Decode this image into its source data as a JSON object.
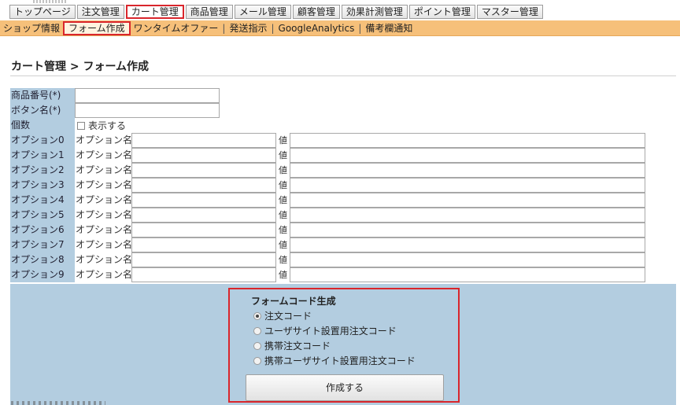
{
  "nav": {
    "tabs": [
      {
        "label": "トップページ",
        "active": false
      },
      {
        "label": "注文管理",
        "active": false
      },
      {
        "label": "カート管理",
        "active": true
      },
      {
        "label": "商品管理",
        "active": false
      },
      {
        "label": "メール管理",
        "active": false
      },
      {
        "label": "顧客管理",
        "active": false
      },
      {
        "label": "効果計測管理",
        "active": false
      },
      {
        "label": "ポイント管理",
        "active": false
      },
      {
        "label": "マスター管理",
        "active": false
      }
    ],
    "subnav": [
      {
        "label": "ショップ情報",
        "current": false
      },
      {
        "label": "フォーム作成",
        "current": true
      },
      {
        "label": "ワンタイムオファー",
        "current": false
      },
      {
        "label": "発送指示",
        "current": false
      },
      {
        "label": "GoogleAnalytics",
        "current": false
      },
      {
        "label": "備考欄通知",
        "current": false
      }
    ],
    "separator": "|"
  },
  "page": {
    "title": "カート管理 > フォーム作成"
  },
  "form": {
    "product_number_label": "商品番号(*)",
    "product_number_value": "",
    "button_name_label": "ボタン名(*)",
    "button_name_value": "",
    "quantity_label": "個数",
    "quantity_checkbox_label": "表示する",
    "option_name_label": "オプション名",
    "value_label": "値",
    "options": [
      {
        "label": "オプション0",
        "name": "",
        "value": ""
      },
      {
        "label": "オプション1",
        "name": "",
        "value": ""
      },
      {
        "label": "オプション2",
        "name": "",
        "value": ""
      },
      {
        "label": "オプション3",
        "name": "",
        "value": ""
      },
      {
        "label": "オプション4",
        "name": "",
        "value": ""
      },
      {
        "label": "オプション5",
        "name": "",
        "value": ""
      },
      {
        "label": "オプション6",
        "name": "",
        "value": ""
      },
      {
        "label": "オプション7",
        "name": "",
        "value": ""
      },
      {
        "label": "オプション8",
        "name": "",
        "value": ""
      },
      {
        "label": "オプション9",
        "name": "",
        "value": ""
      }
    ]
  },
  "generator": {
    "title": "フォームコード生成",
    "options": [
      {
        "label": "注文コード",
        "selected": true
      },
      {
        "label": "ユーザサイト設置用注文コード",
        "selected": false
      },
      {
        "label": "携帯注文コード",
        "selected": false
      },
      {
        "label": "携帯ユーザサイト設置用注文コード",
        "selected": false
      }
    ],
    "submit_label": "作成する"
  },
  "colors": {
    "accent_red": "#d9262c",
    "subnav_orange": "#f6c07a",
    "label_blue": "#b3cde0"
  }
}
